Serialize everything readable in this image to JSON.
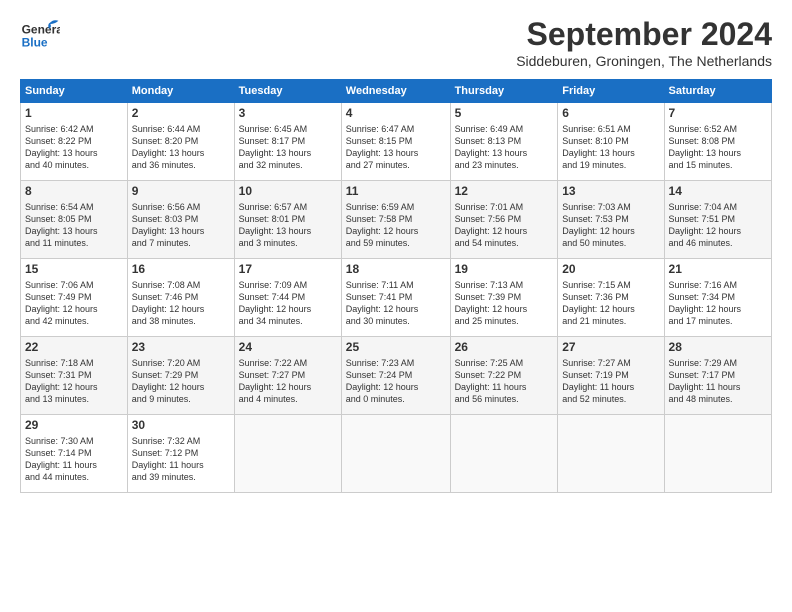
{
  "header": {
    "logo_line1": "General",
    "logo_line2": "Blue",
    "month": "September 2024",
    "location": "Siddeburen, Groningen, The Netherlands"
  },
  "weekdays": [
    "Sunday",
    "Monday",
    "Tuesday",
    "Wednesday",
    "Thursday",
    "Friday",
    "Saturday"
  ],
  "weeks": [
    [
      {
        "day": "1",
        "info": "Sunrise: 6:42 AM\nSunset: 8:22 PM\nDaylight: 13 hours\nand 40 minutes."
      },
      {
        "day": "2",
        "info": "Sunrise: 6:44 AM\nSunset: 8:20 PM\nDaylight: 13 hours\nand 36 minutes."
      },
      {
        "day": "3",
        "info": "Sunrise: 6:45 AM\nSunset: 8:17 PM\nDaylight: 13 hours\nand 32 minutes."
      },
      {
        "day": "4",
        "info": "Sunrise: 6:47 AM\nSunset: 8:15 PM\nDaylight: 13 hours\nand 27 minutes."
      },
      {
        "day": "5",
        "info": "Sunrise: 6:49 AM\nSunset: 8:13 PM\nDaylight: 13 hours\nand 23 minutes."
      },
      {
        "day": "6",
        "info": "Sunrise: 6:51 AM\nSunset: 8:10 PM\nDaylight: 13 hours\nand 19 minutes."
      },
      {
        "day": "7",
        "info": "Sunrise: 6:52 AM\nSunset: 8:08 PM\nDaylight: 13 hours\nand 15 minutes."
      }
    ],
    [
      {
        "day": "8",
        "info": "Sunrise: 6:54 AM\nSunset: 8:05 PM\nDaylight: 13 hours\nand 11 minutes."
      },
      {
        "day": "9",
        "info": "Sunrise: 6:56 AM\nSunset: 8:03 PM\nDaylight: 13 hours\nand 7 minutes."
      },
      {
        "day": "10",
        "info": "Sunrise: 6:57 AM\nSunset: 8:01 PM\nDaylight: 13 hours\nand 3 minutes."
      },
      {
        "day": "11",
        "info": "Sunrise: 6:59 AM\nSunset: 7:58 PM\nDaylight: 12 hours\nand 59 minutes."
      },
      {
        "day": "12",
        "info": "Sunrise: 7:01 AM\nSunset: 7:56 PM\nDaylight: 12 hours\nand 54 minutes."
      },
      {
        "day": "13",
        "info": "Sunrise: 7:03 AM\nSunset: 7:53 PM\nDaylight: 12 hours\nand 50 minutes."
      },
      {
        "day": "14",
        "info": "Sunrise: 7:04 AM\nSunset: 7:51 PM\nDaylight: 12 hours\nand 46 minutes."
      }
    ],
    [
      {
        "day": "15",
        "info": "Sunrise: 7:06 AM\nSunset: 7:49 PM\nDaylight: 12 hours\nand 42 minutes."
      },
      {
        "day": "16",
        "info": "Sunrise: 7:08 AM\nSunset: 7:46 PM\nDaylight: 12 hours\nand 38 minutes."
      },
      {
        "day": "17",
        "info": "Sunrise: 7:09 AM\nSunset: 7:44 PM\nDaylight: 12 hours\nand 34 minutes."
      },
      {
        "day": "18",
        "info": "Sunrise: 7:11 AM\nSunset: 7:41 PM\nDaylight: 12 hours\nand 30 minutes."
      },
      {
        "day": "19",
        "info": "Sunrise: 7:13 AM\nSunset: 7:39 PM\nDaylight: 12 hours\nand 25 minutes."
      },
      {
        "day": "20",
        "info": "Sunrise: 7:15 AM\nSunset: 7:36 PM\nDaylight: 12 hours\nand 21 minutes."
      },
      {
        "day": "21",
        "info": "Sunrise: 7:16 AM\nSunset: 7:34 PM\nDaylight: 12 hours\nand 17 minutes."
      }
    ],
    [
      {
        "day": "22",
        "info": "Sunrise: 7:18 AM\nSunset: 7:31 PM\nDaylight: 12 hours\nand 13 minutes."
      },
      {
        "day": "23",
        "info": "Sunrise: 7:20 AM\nSunset: 7:29 PM\nDaylight: 12 hours\nand 9 minutes."
      },
      {
        "day": "24",
        "info": "Sunrise: 7:22 AM\nSunset: 7:27 PM\nDaylight: 12 hours\nand 4 minutes."
      },
      {
        "day": "25",
        "info": "Sunrise: 7:23 AM\nSunset: 7:24 PM\nDaylight: 12 hours\nand 0 minutes."
      },
      {
        "day": "26",
        "info": "Sunrise: 7:25 AM\nSunset: 7:22 PM\nDaylight: 11 hours\nand 56 minutes."
      },
      {
        "day": "27",
        "info": "Sunrise: 7:27 AM\nSunset: 7:19 PM\nDaylight: 11 hours\nand 52 minutes."
      },
      {
        "day": "28",
        "info": "Sunrise: 7:29 AM\nSunset: 7:17 PM\nDaylight: 11 hours\nand 48 minutes."
      }
    ],
    [
      {
        "day": "29",
        "info": "Sunrise: 7:30 AM\nSunset: 7:14 PM\nDaylight: 11 hours\nand 44 minutes."
      },
      {
        "day": "30",
        "info": "Sunrise: 7:32 AM\nSunset: 7:12 PM\nDaylight: 11 hours\nand 39 minutes."
      },
      {
        "day": "",
        "info": ""
      },
      {
        "day": "",
        "info": ""
      },
      {
        "day": "",
        "info": ""
      },
      {
        "day": "",
        "info": ""
      },
      {
        "day": "",
        "info": ""
      }
    ]
  ]
}
